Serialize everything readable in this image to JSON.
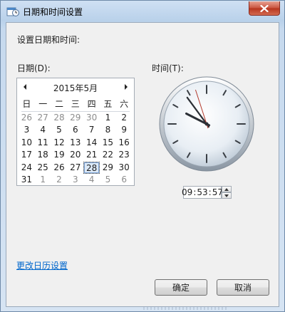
{
  "window": {
    "title": "日期和时间设置"
  },
  "main": {
    "heading": "设置日期和时间:",
    "date_label": "日期(D):",
    "time_label": "时间(T):"
  },
  "calendar": {
    "month_label": "2015年5月",
    "weekdays": [
      "日",
      "一",
      "二",
      "三",
      "四",
      "五",
      "六"
    ],
    "weeks": [
      [
        {
          "d": "26",
          "other": true
        },
        {
          "d": "27",
          "other": true
        },
        {
          "d": "28",
          "other": true
        },
        {
          "d": "29",
          "other": true
        },
        {
          "d": "30",
          "other": true
        },
        {
          "d": "1"
        },
        {
          "d": "2"
        }
      ],
      [
        {
          "d": "3"
        },
        {
          "d": "4"
        },
        {
          "d": "5"
        },
        {
          "d": "6"
        },
        {
          "d": "7"
        },
        {
          "d": "8"
        },
        {
          "d": "9"
        }
      ],
      [
        {
          "d": "10"
        },
        {
          "d": "11"
        },
        {
          "d": "12"
        },
        {
          "d": "13"
        },
        {
          "d": "14"
        },
        {
          "d": "15"
        },
        {
          "d": "16"
        }
      ],
      [
        {
          "d": "17"
        },
        {
          "d": "18"
        },
        {
          "d": "19"
        },
        {
          "d": "20"
        },
        {
          "d": "21"
        },
        {
          "d": "22"
        },
        {
          "d": "23"
        }
      ],
      [
        {
          "d": "24"
        },
        {
          "d": "25"
        },
        {
          "d": "26"
        },
        {
          "d": "27"
        },
        {
          "d": "28",
          "selected": true
        },
        {
          "d": "29"
        },
        {
          "d": "30"
        }
      ],
      [
        {
          "d": "31"
        },
        {
          "d": "1",
          "other": true
        },
        {
          "d": "2",
          "other": true
        },
        {
          "d": "3",
          "other": true
        },
        {
          "d": "4",
          "other": true
        },
        {
          "d": "5",
          "other": true
        },
        {
          "d": "6",
          "other": true
        }
      ]
    ]
  },
  "clock": {
    "hours": 9,
    "minutes": 53,
    "seconds": 57
  },
  "time_field": {
    "hh": "09",
    "mm": "53",
    "ss": "57",
    "separator": ":"
  },
  "link": {
    "calendar_settings": "更改日历设置"
  },
  "buttons": {
    "ok": "确定",
    "cancel": "取消"
  },
  "icons": {
    "title": "date-time-settings-icon",
    "close": "close-icon",
    "prev": "chevron-left-icon",
    "next": "chevron-right-icon",
    "spin_up": "spin-up-icon",
    "spin_down": "spin-down-icon"
  },
  "colors": {
    "link": "#0066cc",
    "close_button": "#c9523d",
    "selection": "#dce9f7"
  }
}
